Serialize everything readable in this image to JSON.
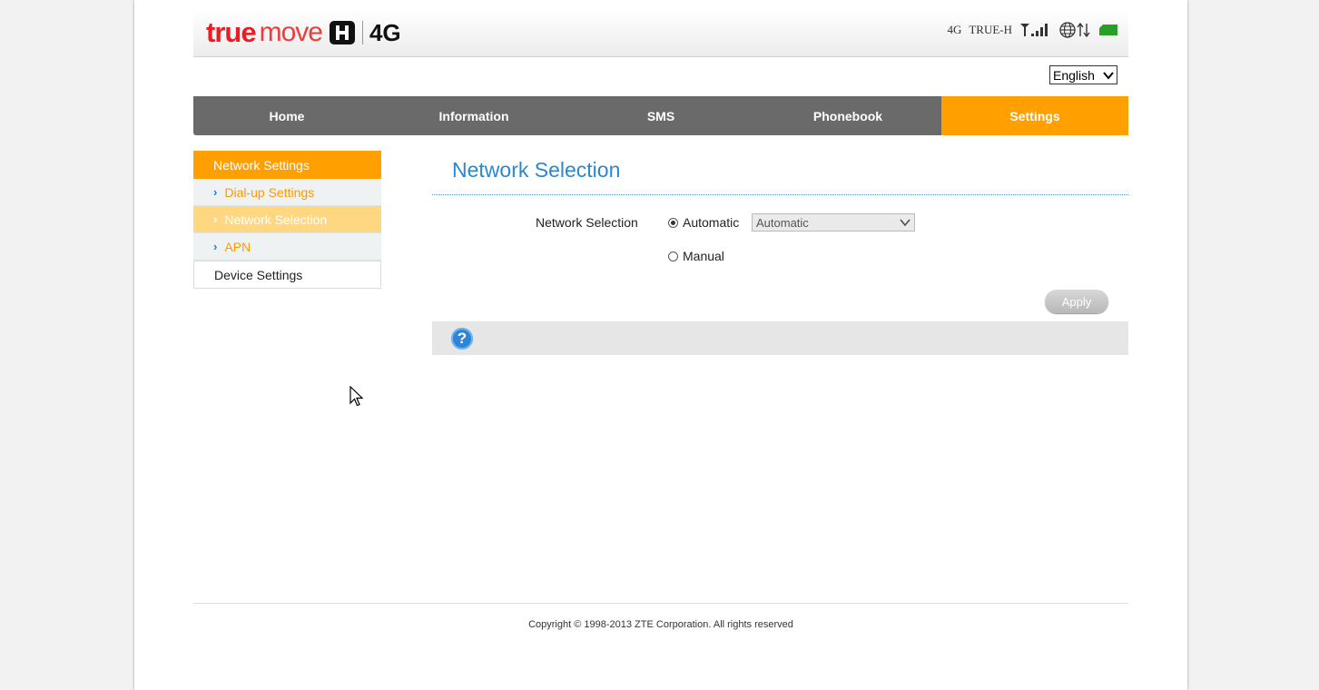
{
  "brand": {
    "true": "true",
    "move": "move",
    "network": "4G"
  },
  "status": {
    "network_type": "4G",
    "operator": "TRUE-H",
    "signal": "signal-bars",
    "connection": "globe-updown",
    "sim": "sim-icon"
  },
  "language": {
    "selected": "English"
  },
  "nav": {
    "items": [
      "Home",
      "Information",
      "SMS",
      "Phonebook",
      "Settings"
    ],
    "active": "Settings"
  },
  "sidebar": {
    "header": "Network Settings",
    "items": [
      "Dial-up Settings",
      "Network Selection",
      "APN"
    ],
    "active": "Network Selection",
    "device": "Device Settings"
  },
  "content": {
    "title": "Network Selection",
    "field_label": "Network Selection",
    "automatic_label": "Automatic",
    "manual_label": "Manual",
    "select_value": "Automatic",
    "selected_option": "Automatic",
    "apply": "Apply"
  },
  "help": {
    "icon": "?"
  },
  "footer": {
    "copyright": "Copyright © 1998-2013 ZTE Corporation. All rights reserved"
  },
  "colors": {
    "accent": "#ff9f00",
    "nav_bg": "#6a6a6a",
    "title": "#2a88cf"
  }
}
